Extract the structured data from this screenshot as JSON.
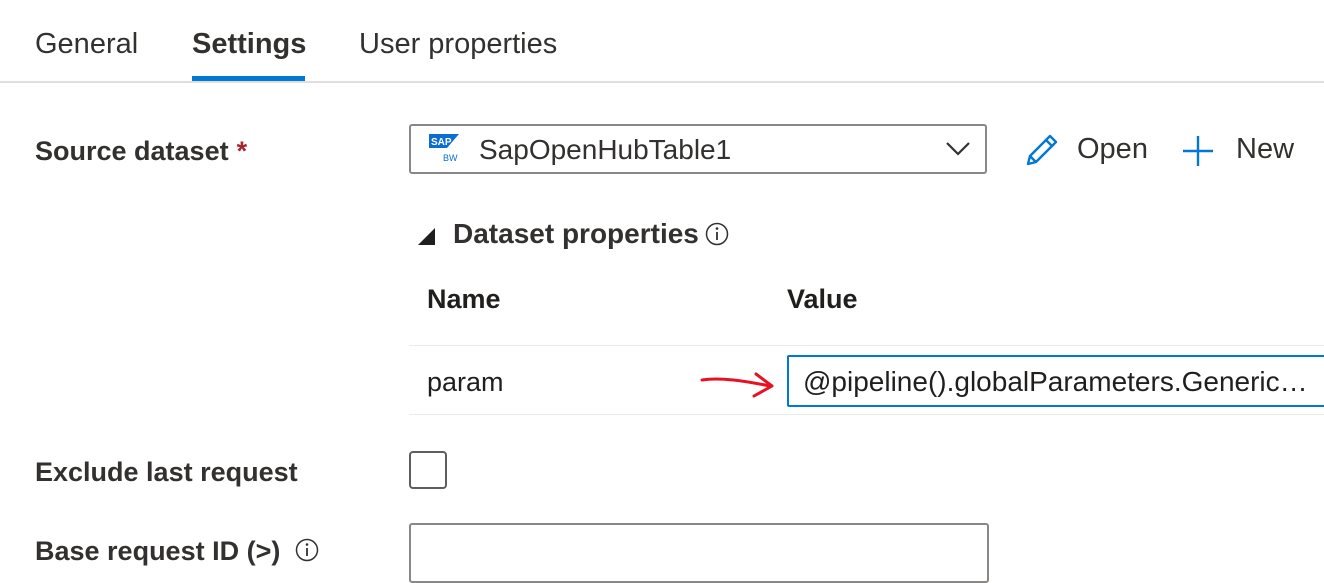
{
  "tabs": [
    {
      "label": "General",
      "active": false
    },
    {
      "label": "Settings",
      "active": true
    },
    {
      "label": "User properties",
      "active": false
    }
  ],
  "source_dataset": {
    "label": "Source dataset",
    "required_mark": "*",
    "selected_value": "SapOpenHubTable1",
    "logo_text": "SAP",
    "logo_subtext": "BW",
    "open_label": "Open",
    "new_label": "New"
  },
  "dataset_properties": {
    "title": "Dataset properties",
    "columns": {
      "name": "Name",
      "value": "Value"
    },
    "rows": [
      {
        "name": "param",
        "value": "@pipeline().globalParameters.Generic…"
      }
    ]
  },
  "exclude_last_request": {
    "label": "Exclude last request",
    "checked": false
  },
  "base_request_id": {
    "label": "Base request ID (>)",
    "value": ""
  },
  "colors": {
    "accent": "#0078d4",
    "required": "#a4262c",
    "annotation_arrow": "#e81123",
    "sap_blue": "#0a6ed1"
  },
  "icons": {
    "dropdown": "chevron-down-icon",
    "open": "pencil-icon",
    "new": "plus-icon",
    "info": "info-icon",
    "collapse": "triangle-expanded-icon"
  }
}
